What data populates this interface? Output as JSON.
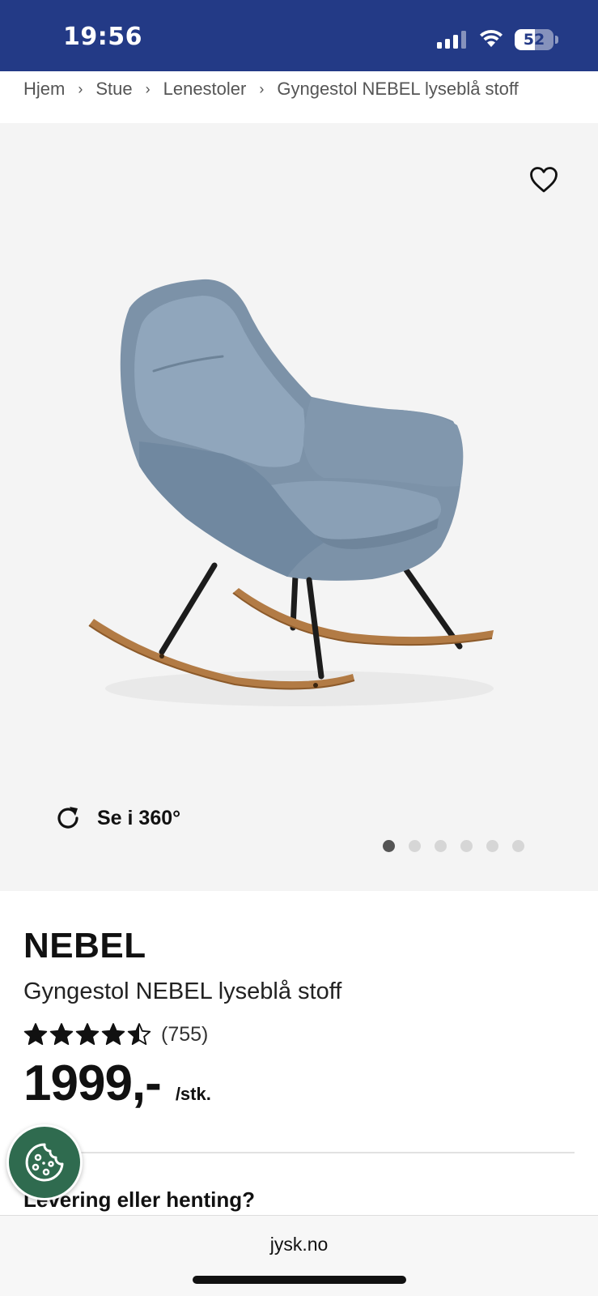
{
  "status_bar": {
    "time": "19:56",
    "battery_percent": "52",
    "battery_level": 0.52,
    "background_color": "#233a86"
  },
  "breadcrumb": [
    {
      "label": "Hjem"
    },
    {
      "label": "Stue"
    },
    {
      "label": "Lenestoler"
    },
    {
      "label": "Gyngestol NEBEL lyseblå stoff"
    }
  ],
  "gallery": {
    "favorite_icon": "heart-outline-icon",
    "view_360_label": "Se i 360°",
    "view_360_icon": "rotate-icon",
    "image_count": 6,
    "active_image_index": 0
  },
  "product": {
    "brand": "NEBEL",
    "name": "Gyngestol NEBEL lyseblå stoff",
    "rating_value": 4.5,
    "rating_max": 5,
    "review_count": "(755)",
    "price": "1999,-",
    "price_unit": "/stk."
  },
  "delivery": {
    "heading": "Levering eller henting?"
  },
  "cookie_button": {
    "icon": "cookie-icon",
    "color": "#2f6b4f"
  },
  "browser": {
    "url": "jysk.no"
  }
}
